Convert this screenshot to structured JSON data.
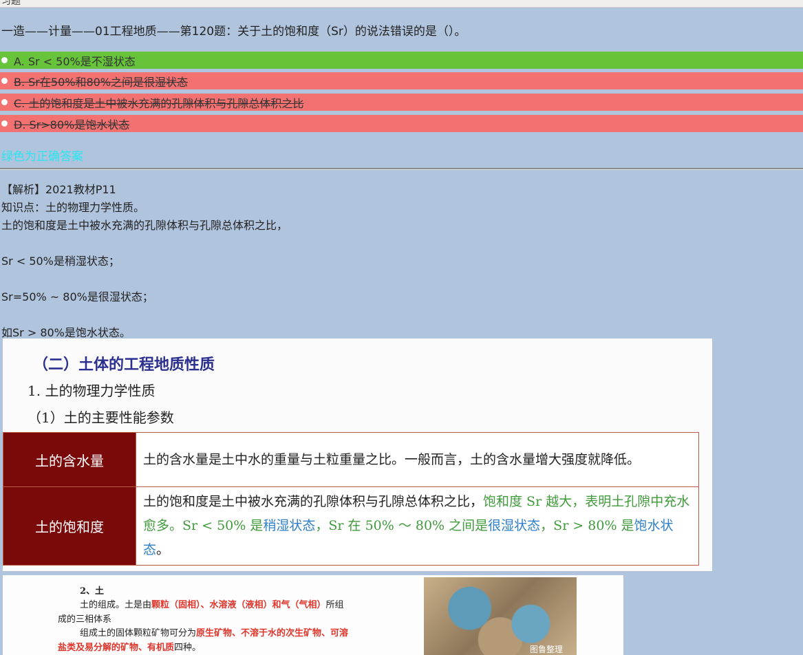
{
  "header": {
    "crumb": "习题"
  },
  "question": {
    "text": "一造——计量——01工程地质——第120题：关于土的饱和度（Sr）的说法错误的是（）。"
  },
  "options": [
    {
      "label": "A. Sr < 50%是不湿状态",
      "status": "correct",
      "color": "#66c33a"
    },
    {
      "label": "B. Sr在50%和80%之间是很湿状态",
      "status": "wrong",
      "color": "#f37171"
    },
    {
      "label": "C. 土的饱和度是土中被水充满的孔隙体积与孔隙总体积之比",
      "status": "wrong",
      "color": "#f37171"
    },
    {
      "label": "D. Sr>80%是饱水状态",
      "status": "wrong",
      "color": "#f37171"
    }
  ],
  "answer_note": {
    "text": "绿色为正确答案",
    "color": "#29e6f0"
  },
  "analysis": {
    "lines": [
      "【解析】2021教材P11",
      "知识点：土的物理力学性质。",
      "土的饱和度是土中被水充满的孔隙体积与孔隙总体积之比，",
      "Sr < 50%是稍湿状态；",
      "Sr=50% ~ 80%是很湿状态；",
      "如Sr > 80%是饱水状态。"
    ]
  },
  "textbook_1": {
    "section_title": "（二）土体的工程地质性质",
    "subsection": "1. 土的物理力学性质",
    "subsubsection": "（1）土的主要性能参数",
    "rows": [
      {
        "term": "土的含水量",
        "desc": "土的含水量是土中水的重量与土粒重量之比。一般而言，土的含水量增大强度就降低。"
      },
      {
        "term": "土的饱和度",
        "desc_plain": "土的饱和度是土中被水充满的孔隙体积与孔隙总体积之比，",
        "desc_green_1": "饱和度 Sr 越大，表明土孔隙中充水愈多。Sr < 50% 是",
        "desc_blue_1": "稍湿状态",
        "desc_green_2": "，Sr 在 50% ～ 80% 之间是",
        "desc_blue_2": "很湿状态",
        "desc_green_3": "，Sr > 80% 是",
        "desc_blue_3": "饱水状态",
        "desc_end": "。"
      }
    ]
  },
  "textbook_2": {
    "heading": "2、土",
    "line1_a": "土的组成。土是由",
    "line1_red": "颗粒（固相）、水溶液（液相）和气（气相）",
    "line1_b": "所组",
    "line2": "成的三相体系",
    "line3_a": "组成土的固体颗粒矿物可分为",
    "line3_red": "原生矿物、不溶于水的次生矿物、可溶",
    "line4_red": "盐类及易分解的矿物、有机质",
    "line4_b": "四种。",
    "watermark": "图鲁整理"
  }
}
